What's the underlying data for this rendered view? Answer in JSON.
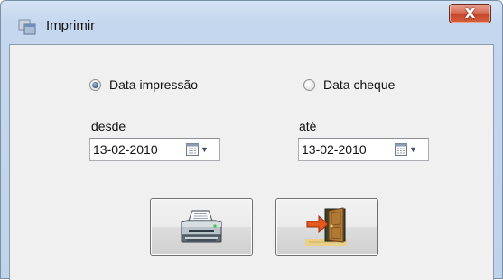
{
  "window": {
    "title": "Imprimir",
    "close_glyph": "X"
  },
  "options": {
    "print_date": {
      "label": "Data impressão",
      "selected": true
    },
    "cheque_date": {
      "label": "Data cheque",
      "selected": false
    }
  },
  "range": {
    "from": {
      "label": "desde",
      "value": "13-02-2010"
    },
    "to": {
      "label": "até",
      "value": "13-02-2010"
    },
    "dropdown_glyph": "▼"
  },
  "actions": {
    "print_icon": "printer-icon",
    "exit_icon": "exit-door-icon"
  },
  "colors": {
    "close_button": "#c6462b",
    "dialog_background": "#f0f0f0",
    "window_frame": "#bfd3ea"
  }
}
